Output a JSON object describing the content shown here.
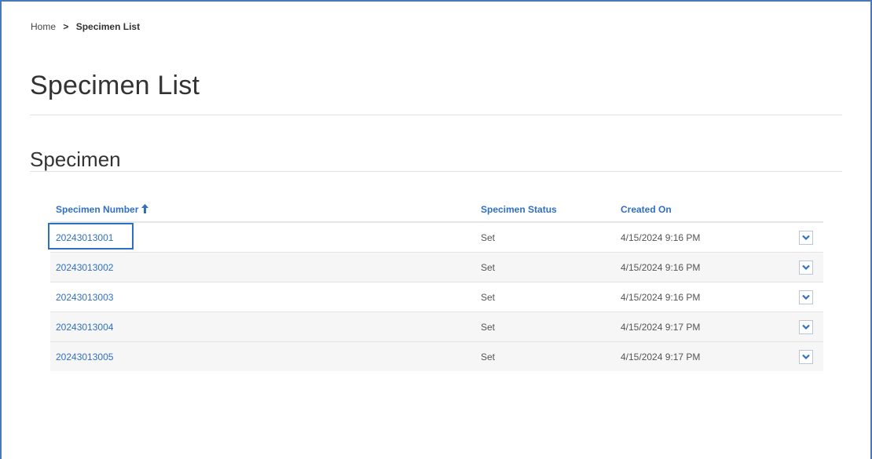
{
  "breadcrumb": {
    "home": "Home",
    "separator": ">",
    "current": "Specimen List"
  },
  "page_title": "Specimen List",
  "section_title": "Specimen",
  "grid": {
    "columns": {
      "number": "Specimen Number",
      "status": "Specimen Status",
      "created": "Created On"
    },
    "sort": {
      "column": "number",
      "direction": "ascending",
      "icon": "arrow-up-icon"
    },
    "rows": [
      {
        "number": "20243013001",
        "status": "Set",
        "created": "4/15/2024 9:16 PM"
      },
      {
        "number": "20243013002",
        "status": "Set",
        "created": "4/15/2024 9:16 PM"
      },
      {
        "number": "20243013003",
        "status": "Set",
        "created": "4/15/2024 9:16 PM"
      },
      {
        "number": "20243013004",
        "status": "Set",
        "created": "4/15/2024 9:17 PM"
      },
      {
        "number": "20243013005",
        "status": "Set",
        "created": "4/15/2024 9:17 PM"
      }
    ],
    "row_action_icon": "chevron-down-icon"
  },
  "colors": {
    "accent": "#2f6fc4",
    "frame": "#4a78b5",
    "alt_row": "#f6f6f6"
  }
}
